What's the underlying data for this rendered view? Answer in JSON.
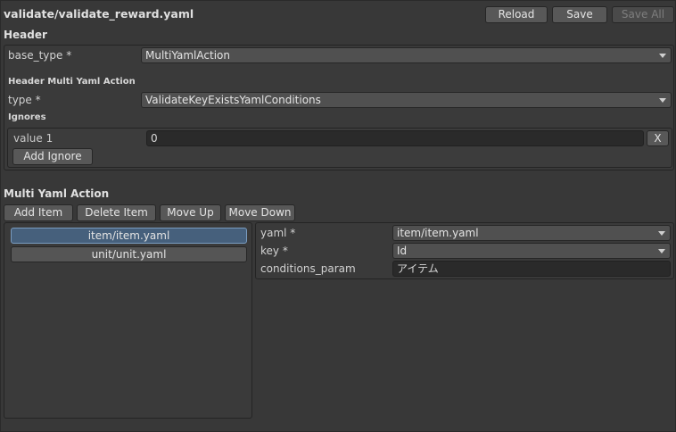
{
  "window": {
    "title": "validate/validate_reward.yaml"
  },
  "toolbar": {
    "reload_label": "Reload",
    "save_label": "Save",
    "save_all_label": "Save All"
  },
  "header_section": {
    "title": "Header",
    "base_type": {
      "label": "base_type *",
      "value": "MultiYamlAction"
    },
    "multi_yaml_action_header": "Header Multi Yaml Action",
    "type": {
      "label": "type *",
      "value": "ValidateKeyExistsYamlConditions"
    },
    "ignores": {
      "title": "Ignores",
      "items": [
        {
          "label": "value 1",
          "value": "0",
          "remove_label": "X"
        }
      ],
      "add_label": "Add Ignore"
    }
  },
  "multi_yaml_section": {
    "title": "Multi Yaml Action",
    "buttons": {
      "add_item": "Add Item",
      "delete_item": "Delete Item",
      "move_up": "Move Up",
      "move_down": "Move Down"
    },
    "list": [
      {
        "label": "item/item.yaml",
        "selected": true
      },
      {
        "label": "unit/unit.yaml",
        "selected": false
      }
    ],
    "detail": {
      "yaml": {
        "label": "yaml *",
        "value": "item/item.yaml"
      },
      "key": {
        "label": "key *",
        "value": "Id"
      },
      "conditions_param": {
        "label": "conditions_param",
        "value": "アイテム"
      }
    }
  },
  "colors": {
    "background": "#383838",
    "selected_item": "#46607c",
    "selected_border": "#7a9cc0"
  }
}
